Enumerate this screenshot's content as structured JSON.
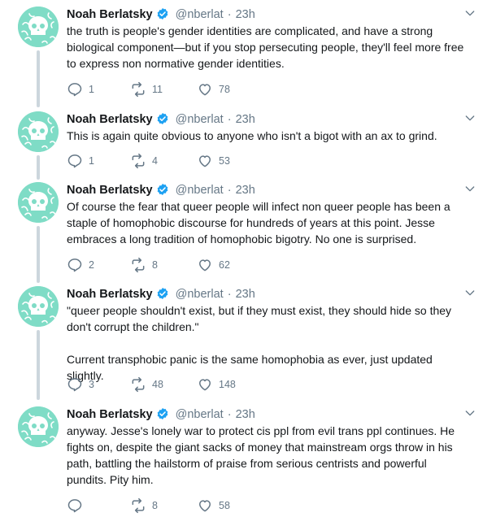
{
  "author": {
    "name": "Noah Berlatsky",
    "handle": "@nberlat",
    "dot": "·",
    "time": "23h"
  },
  "colors": {
    "avatar_bg": "#7fdcc6",
    "thread_line": "#ccd6dd",
    "verified": "#1da1f2",
    "muted": "#657786"
  },
  "tweets": [
    {
      "text": "the truth is people's gender identities are complicated, and have a strong biological component—but if you stop persecuting people, they'll feel more free to express non normative gender identities.",
      "replies": "1",
      "retweets": "11",
      "likes": "78"
    },
    {
      "text": "This is again quite obvious to anyone who isn't a bigot with an ax to grind.",
      "replies": "1",
      "retweets": "4",
      "likes": "53"
    },
    {
      "text": "Of course the fear that queer people will infect non queer people has been a staple of homophobic discourse for hundreds of years at this point. Jesse embraces a long tradition of homophobic bigotry. No one is surprised.",
      "replies": "2",
      "retweets": "8",
      "likes": "62"
    },
    {
      "text": "\"queer people shouldn't exist, but if they must exist, they should hide so they don't corrupt the children.\"\n\nCurrent transphobic panic is the same homophobia as ever, just updated slightly.",
      "replies": "3",
      "retweets": "48",
      "likes": "148"
    },
    {
      "text": "anyway. Jesse's lonely war to protect cis ppl from evil trans ppl continues. He fights on, despite the giant sacks of money that mainstream orgs throw in his path, battling the hailstorm of praise from serious centrists and powerful pundits. Pity him.",
      "replies": "",
      "retweets": "8",
      "likes": "58"
    }
  ]
}
